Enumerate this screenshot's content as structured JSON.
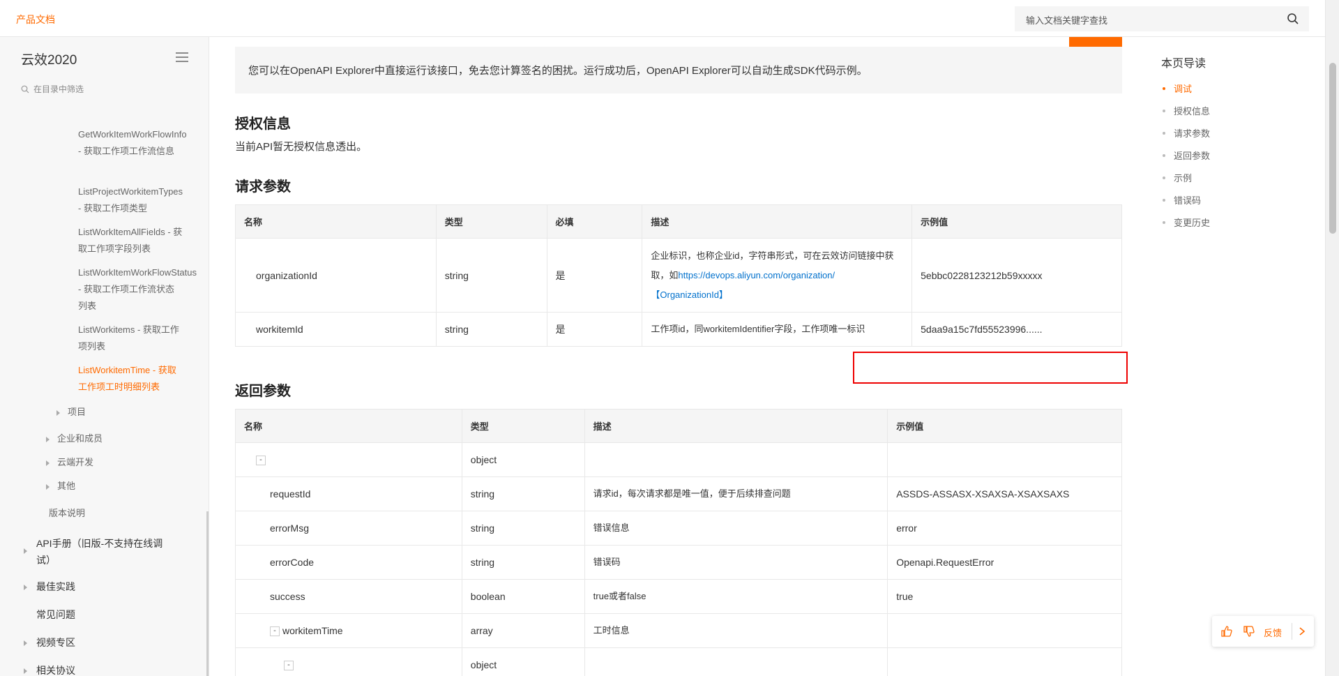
{
  "header": {
    "brand": "产品文档",
    "search_placeholder": "输入文档关键字查找"
  },
  "sidebar": {
    "title": "云效2020",
    "filter_placeholder": "在目录中筛选",
    "items": [
      {
        "label": "GetWorkItemWorkFlowInfo - 获取工作项工作流信息"
      },
      {
        "label": "ListProjectWorkitemTypes - 获取工作项类型"
      },
      {
        "label": "ListWorkItemAllFields - 获取工作项字段列表"
      },
      {
        "label": "ListWorkItemWorkFlowStatus - 获取工作项工作流状态列表"
      },
      {
        "label": "ListWorkitems - 获取工作项列表"
      },
      {
        "label": "ListWorkitemTime - 获取工作项工时明细列表"
      },
      {
        "label": "项目"
      },
      {
        "label": "企业和成员"
      },
      {
        "label": "云端开发"
      },
      {
        "label": "其他"
      },
      {
        "label": "版本说明"
      },
      {
        "label": "API手册（旧版-不支持在线调试）"
      },
      {
        "label": "最佳实践"
      },
      {
        "label": "常见问题"
      },
      {
        "label": "视频专区"
      },
      {
        "label": "相关协议"
      }
    ]
  },
  "debug": {
    "text": "您可以在OpenAPI Explorer中直接运行该接口，免去您计算签名的困扰。运行成功后，OpenAPI Explorer可以自动生成SDK代码示例。"
  },
  "auth": {
    "heading": "授权信息",
    "text": "当前API暂无授权信息透出。"
  },
  "request": {
    "heading": "请求参数",
    "columns": [
      "名称",
      "类型",
      "必填",
      "描述",
      "示例值"
    ],
    "rows": [
      {
        "name": "organizationId",
        "type": "string",
        "required": "是",
        "desc_prefix": "企业标识，也称企业id，字符串形式，可在云效访问链接中获取，如",
        "desc_link": "https://devops.aliyun.com/organization/【OrganizationId】",
        "example": "5ebbc0228123212b59xxxxx"
      },
      {
        "name": "workitemId",
        "type": "string",
        "required": "是",
        "desc": "工作项id，同workitemIdentifier字段，工作项唯一标识",
        "example": "5daa9a15c7fd55523996......"
      }
    ]
  },
  "response": {
    "heading": "返回参数",
    "columns": [
      "名称",
      "类型",
      "描述",
      "示例值"
    ],
    "rows": [
      {
        "toggle": "-",
        "name": "",
        "type": "object",
        "desc": "",
        "example": ""
      },
      {
        "toggle": "",
        "name": "requestId",
        "type": "string",
        "desc": "请求id，每次请求都是唯一值，便于后续排查问题",
        "example": "ASSDS-ASSASX-XSAXSA-XSAXSAXS"
      },
      {
        "toggle": "",
        "name": "errorMsg",
        "type": "string",
        "desc": "错误信息",
        "example": "error"
      },
      {
        "toggle": "",
        "name": "errorCode",
        "type": "string",
        "desc": "错误码",
        "example": "Openapi.RequestError"
      },
      {
        "toggle": "",
        "name": "success",
        "type": "boolean",
        "desc": "true或者false",
        "example": "true"
      },
      {
        "toggle": "-",
        "name": "workitemTime",
        "type": "array",
        "desc": "工时信息",
        "example": ""
      },
      {
        "toggle": "-",
        "name": "",
        "type": "object",
        "desc": "",
        "example": ""
      }
    ]
  },
  "toc": {
    "title": "本页导读",
    "items": [
      "调试",
      "授权信息",
      "请求参数",
      "返回参数",
      "示例",
      "错误码",
      "变更历史"
    ]
  },
  "feedback": {
    "label": "反馈"
  },
  "colors": {
    "accent": "#ff6a00",
    "link": "#0070cc",
    "highlight": "#ee0000"
  }
}
